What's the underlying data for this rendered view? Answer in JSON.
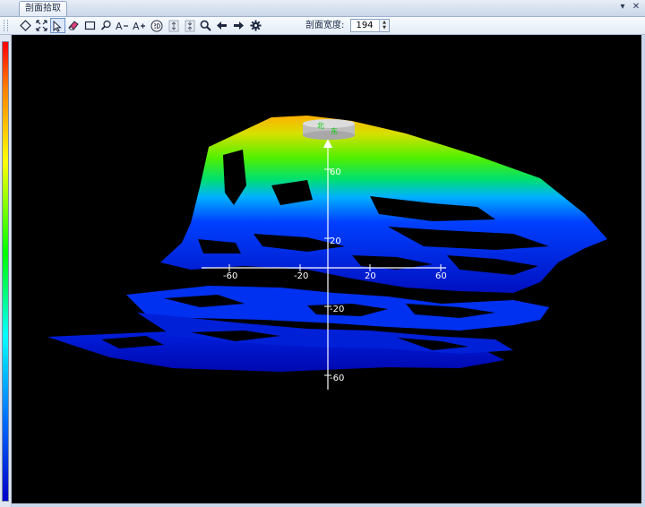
{
  "window": {
    "tab_title": "剖面拾取",
    "menu_glyph": "▾",
    "close_glyph": "✕"
  },
  "toolbar": {
    "width_label": "剖面宽度:",
    "width_value": "194"
  },
  "axes": {
    "horizontal_ticks": [
      "-60",
      "-20",
      "20",
      "60"
    ],
    "vertical_ticks": [
      "60",
      "20",
      "-20",
      "-60"
    ]
  },
  "compass": {
    "north_label": "北",
    "east_label": "东"
  },
  "colors": {
    "background": "#000000",
    "axis": "#ffffff",
    "compass_text": "#00d000",
    "colormap": [
      "#0000c8",
      "#0070ff",
      "#00ffff",
      "#00ff00",
      "#ffff00",
      "#ff8000",
      "#ff0000"
    ]
  }
}
